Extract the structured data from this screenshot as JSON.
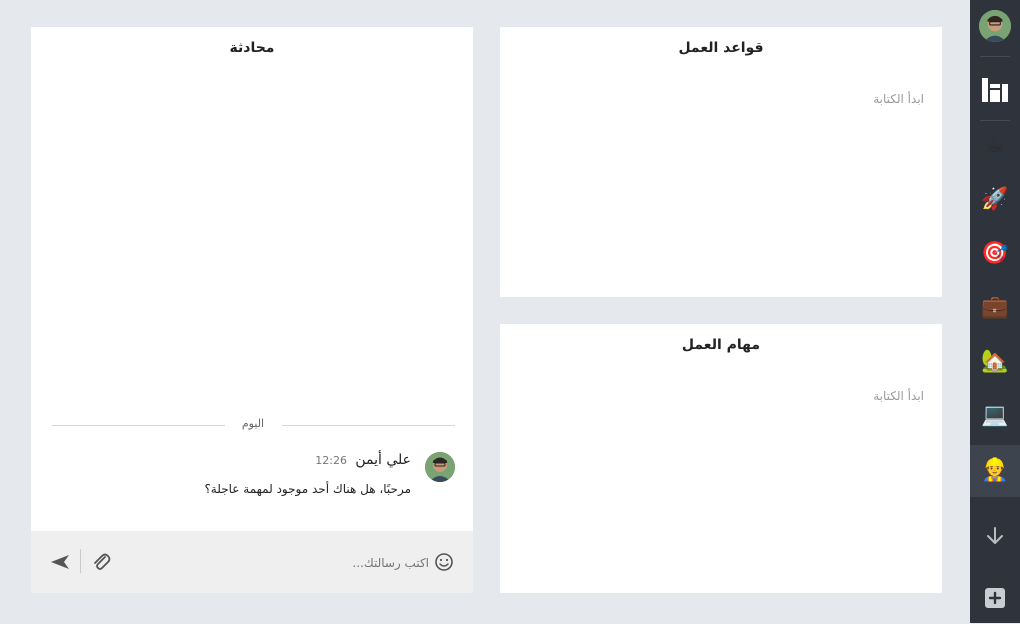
{
  "chat": {
    "title": "محادثة",
    "day_divider": "اليوم",
    "message": {
      "sender": "علي أيمن",
      "time": "12:26",
      "text": "مرحبًا، هل هناك أحد موجود لمهمة عاجلة؟"
    },
    "composer": {
      "placeholder": "اكتب رسالتك..."
    }
  },
  "rules_panel": {
    "title": "قواعد العمل",
    "placeholder": "ابدأ الكتابة"
  },
  "tasks_panel": {
    "title": "مهام العمل",
    "placeholder": "ابدأ الكتابة"
  },
  "rail": {
    "items": [
      {
        "name": "coffee",
        "glyph": "☕"
      },
      {
        "name": "rocket",
        "glyph": "🚀"
      },
      {
        "name": "target",
        "glyph": "🎯"
      },
      {
        "name": "briefcase",
        "glyph": "💼"
      },
      {
        "name": "house",
        "glyph": "🏡"
      },
      {
        "name": "laptop",
        "glyph": "💻"
      },
      {
        "name": "person",
        "glyph": "👷"
      }
    ]
  },
  "colors": {
    "background": "#e5e8ec",
    "rail": "#2f343c",
    "rail_active": "#3e444d",
    "panel": "#ffffff",
    "composer": "#efefef"
  }
}
